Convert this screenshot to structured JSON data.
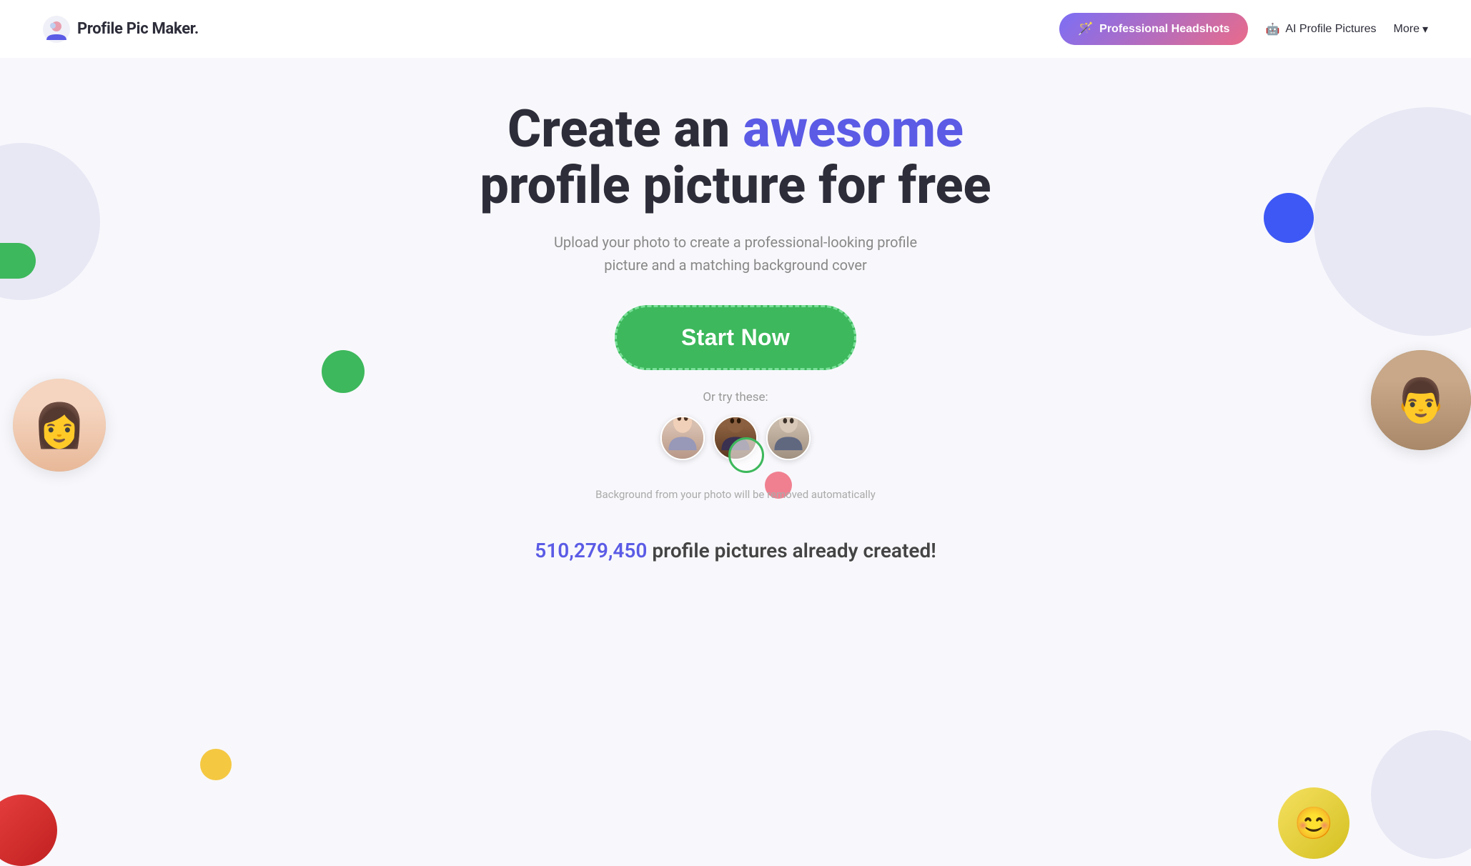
{
  "brand": {
    "logo_text": "Profile Pic Maker",
    "logo_dot": ".",
    "logo_icon": "👤"
  },
  "navbar": {
    "headshots_label": "Professional Headshots",
    "headshots_icon": "🪄",
    "ai_profile_label": "AI Profile Pictures",
    "ai_profile_icon": "🤖",
    "more_label": "More",
    "chevron": "▾"
  },
  "hero": {
    "title_part1": "Create an ",
    "title_highlight": "awesome",
    "title_part2": " profile picture for free",
    "subtitle": "Upload your photo to create a professional-looking profile picture and a matching background cover",
    "cta_label": "Start Now",
    "or_try": "Or try these:",
    "bg_removed_line1": "Background from your photo will be removed automatically"
  },
  "stats": {
    "count": "510,279,450",
    "suffix": " profile pictures already created!"
  },
  "decorative": {
    "blue_dot_color": "#3d58f5",
    "green_color": "#3db85c",
    "pink_color": "#f08090",
    "yellow_color": "#f5c842"
  }
}
